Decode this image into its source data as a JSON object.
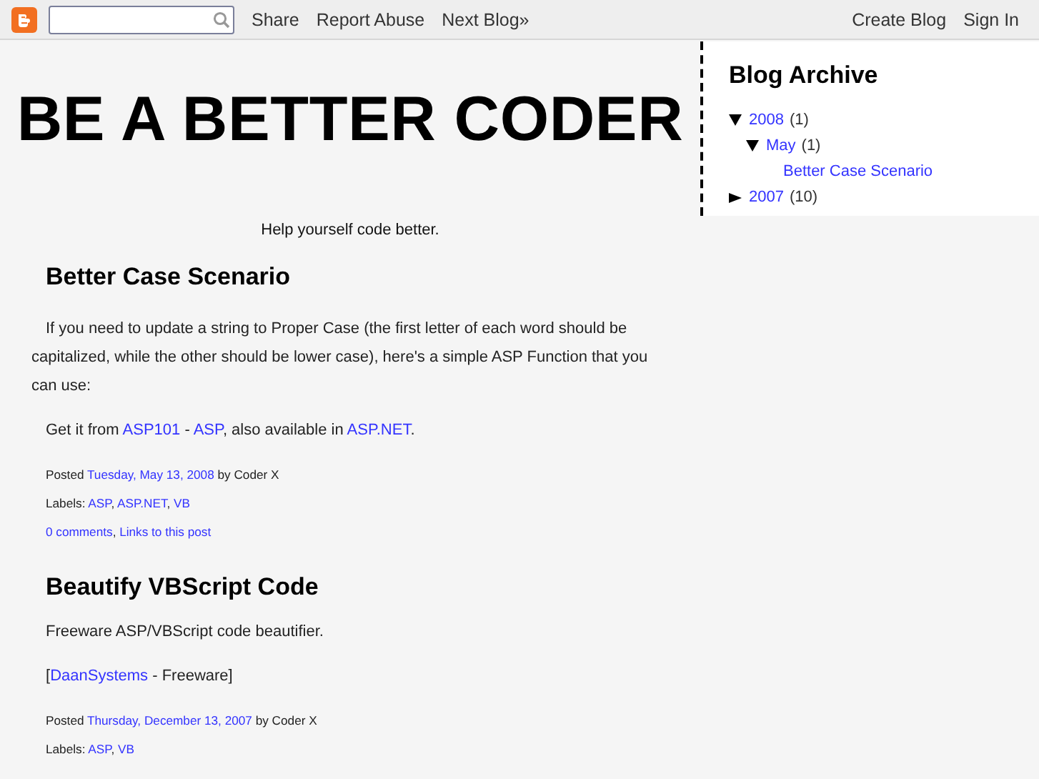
{
  "navbar": {
    "links": [
      "Share",
      "Report Abuse",
      "Next Blog»"
    ],
    "right_links": [
      "Create Blog",
      "Sign In"
    ]
  },
  "blog": {
    "title": "BE A BETTER CODER",
    "description": "Help yourself code better."
  },
  "posts": [
    {
      "title": "Better Case Scenario",
      "paragraphs": [
        [
          {
            "kind": "text",
            "text": "If you need to update a string to Proper Case (the first letter of each word should be capitalized, while the other should be lower case), here's a simple ASP Function that you can use:"
          }
        ],
        [
          {
            "kind": "text",
            "text": "Get it from "
          },
          {
            "kind": "link",
            "text": "ASP101"
          },
          {
            "kind": "text",
            "text": " - "
          },
          {
            "kind": "link",
            "text": "ASP"
          },
          {
            "kind": "text",
            "text": ", also available in "
          },
          {
            "kind": "link",
            "text": "ASP.NET"
          },
          {
            "kind": "text",
            "text": "."
          }
        ]
      ],
      "footer": [
        [
          {
            "kind": "text",
            "text": "Posted "
          },
          {
            "kind": "link",
            "text": "Tuesday, May 13, 2008"
          },
          {
            "kind": "text",
            "text": " by Coder X"
          }
        ],
        [
          {
            "kind": "text",
            "text": "Labels: "
          },
          {
            "kind": "link",
            "text": "ASP"
          },
          {
            "kind": "text",
            "text": ", "
          },
          {
            "kind": "link",
            "text": "ASP.NET"
          },
          {
            "kind": "text",
            "text": ", "
          },
          {
            "kind": "link",
            "text": "VB"
          }
        ],
        [
          {
            "kind": "link",
            "text": "0 comments"
          },
          {
            "kind": "text",
            "text": ", "
          },
          {
            "kind": "link",
            "text": "Links to this post"
          }
        ]
      ]
    },
    {
      "title": "Beautify VBScript Code",
      "paragraphs": [
        [
          {
            "kind": "text",
            "text": "Freeware ASP/VBScript code beautifier."
          }
        ],
        [
          {
            "kind": "text",
            "text": "["
          },
          {
            "kind": "link",
            "text": "DaanSystems"
          },
          {
            "kind": "text",
            "text": " - Freeware]"
          }
        ]
      ],
      "footer": [
        [
          {
            "kind": "text",
            "text": "Posted "
          },
          {
            "kind": "link",
            "text": "Thursday, December 13, 2007"
          },
          {
            "kind": "text",
            "text": " by Coder X"
          }
        ],
        [
          {
            "kind": "text",
            "text": "Labels: "
          },
          {
            "kind": "link",
            "text": "ASP"
          },
          {
            "kind": "text",
            "text": ", "
          },
          {
            "kind": "link",
            "text": "VB"
          }
        ]
      ]
    }
  ],
  "sidebar": {
    "title": "Blog Archive",
    "items": [
      {
        "label": "2008",
        "count": "(1)",
        "expanded": true,
        "children": [
          {
            "label": "May",
            "count": "(1)",
            "expanded": true,
            "children": [
              {
                "label": "Better Case Scenario"
              }
            ]
          }
        ]
      },
      {
        "label": "2007",
        "count": "(10)",
        "expanded": false
      }
    ]
  }
}
